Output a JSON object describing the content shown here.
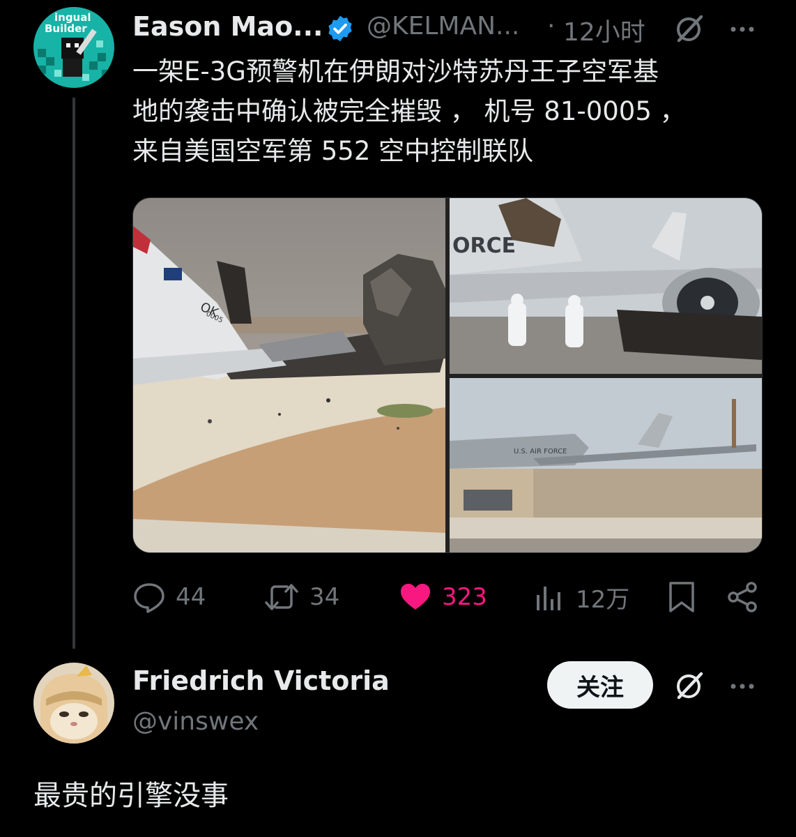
{
  "post": {
    "author_name": "Eason Mao...",
    "handle": "@KELMAN...",
    "separator": "·",
    "time": "12小时",
    "text_lines": [
      "一架E-3G预警机在伊朗对沙特苏丹王子空军基",
      "地的袭击中确认被完全摧毁 ， 机号 81-0005 ，",
      "来自美国空军第 552 空中控制联队"
    ],
    "avatar_text": [
      "ingual",
      "Builder"
    ],
    "images": {
      "left_tail_code": "OK",
      "left_serial": "0005",
      "top_right_fuselage": "ORCE",
      "bottom_right_fuselage": "U.S. AIR FORCE"
    },
    "stats": {
      "replies": "44",
      "reposts": "34",
      "likes": "323",
      "views": "12万"
    },
    "colors": {
      "verified": "#1d9bf0",
      "like": "#f91880",
      "muted": "#71767b"
    }
  },
  "reply": {
    "author_name": "Friedrich Victoria",
    "handle": "@vinswex",
    "follow_label": "关注",
    "text": "最贵的引擎没事"
  },
  "icons": [
    "grok-icon",
    "more-icon",
    "reply-icon",
    "repost-icon",
    "like-icon",
    "views-icon",
    "bookmark-icon",
    "share-icon",
    "verified-badge-icon"
  ]
}
